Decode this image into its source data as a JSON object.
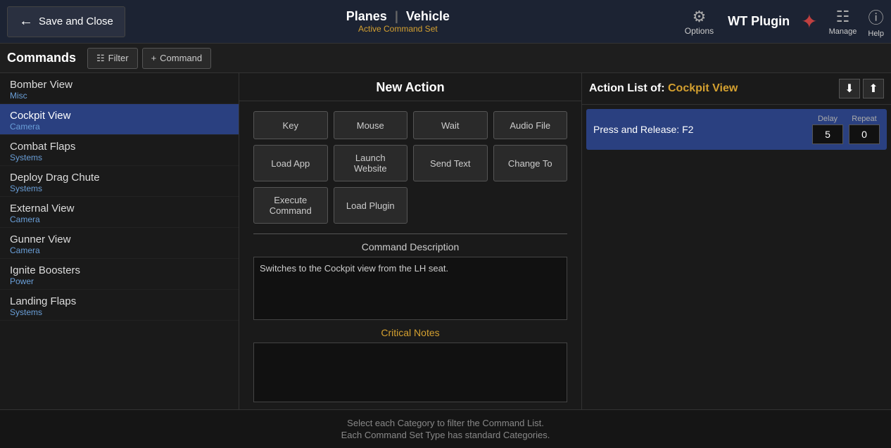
{
  "header": {
    "save_close_label": "Save and Close",
    "title_planes": "Planes",
    "title_separator": "|",
    "title_vehicle": "Vehicle",
    "active_command_set": "Active Command Set",
    "options_label": "Options",
    "wt_plugin_label": "WT Plugin",
    "manage_label": "Manage",
    "help_label": "Help"
  },
  "toolbar": {
    "commands_label": "Commands",
    "filter_label": "Filter",
    "command_label": "Command"
  },
  "commands": [
    {
      "name": "Bomber View",
      "category": "Misc"
    },
    {
      "name": "Cockpit View",
      "category": "Camera",
      "selected": true
    },
    {
      "name": "Combat Flaps",
      "category": "Systems"
    },
    {
      "name": "Deploy Drag Chute",
      "category": "Systems"
    },
    {
      "name": "External View",
      "category": "Camera"
    },
    {
      "name": "Gunner View",
      "category": "Camera"
    },
    {
      "name": "Ignite Boosters",
      "category": "Power"
    },
    {
      "name": "Landing Flaps",
      "category": "Systems"
    }
  ],
  "new_action": {
    "title": "New Action",
    "buttons": [
      "Key",
      "Mouse",
      "Wait",
      "Audio File",
      "Load App",
      "Launch Website",
      "Send Text",
      "Change To",
      "Execute Command",
      "Load Plugin"
    ]
  },
  "command_description": {
    "label": "Command Description",
    "value": "Switches to the Cockpit view from the LH seat."
  },
  "critical_notes": {
    "label": "Critical Notes",
    "value": ""
  },
  "action_list": {
    "title": "Action List of:",
    "command_name": "Cockpit View",
    "action_row": {
      "text": "Press and Release:  F2",
      "delay_label": "Delay",
      "delay_value": "5",
      "repeat_label": "Repeat",
      "repeat_value": "0"
    }
  },
  "footer": {
    "line1": "Select each Category to filter the Command List.",
    "line2": "Each Command Set Type has standard Categories."
  }
}
